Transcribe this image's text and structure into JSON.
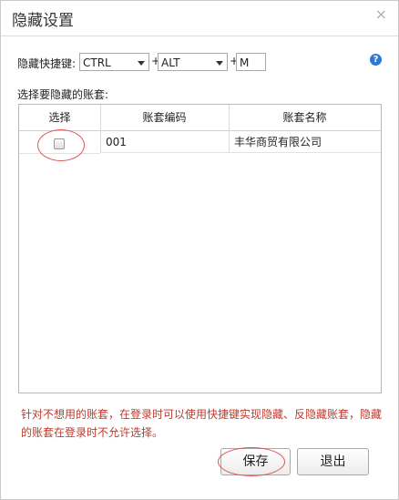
{
  "dialog": {
    "title": "隐藏设置",
    "close_icon": "×"
  },
  "hotkey": {
    "label": "隐藏快捷键:",
    "key1": "CTRL",
    "key2": "ALT",
    "key3": "M",
    "plus": "+",
    "help_icon": "?"
  },
  "accounts_label": "选择要隐藏的账套:",
  "table": {
    "headers": [
      "选择",
      "账套编码",
      "账套名称"
    ],
    "rows": [
      {
        "checked": false,
        "code": "001",
        "name": "丰华商贸有限公司"
      }
    ]
  },
  "note": "针对不想用的账套，在登录时可以使用快捷键实现隐藏、反隐藏账套，隐藏的账套在登录时不允许选择。",
  "buttons": {
    "save": "保存",
    "exit": "退出"
  },
  "colors": {
    "note": "#c0392b",
    "annotation": "#e05555",
    "help": "#2d7ad6"
  }
}
